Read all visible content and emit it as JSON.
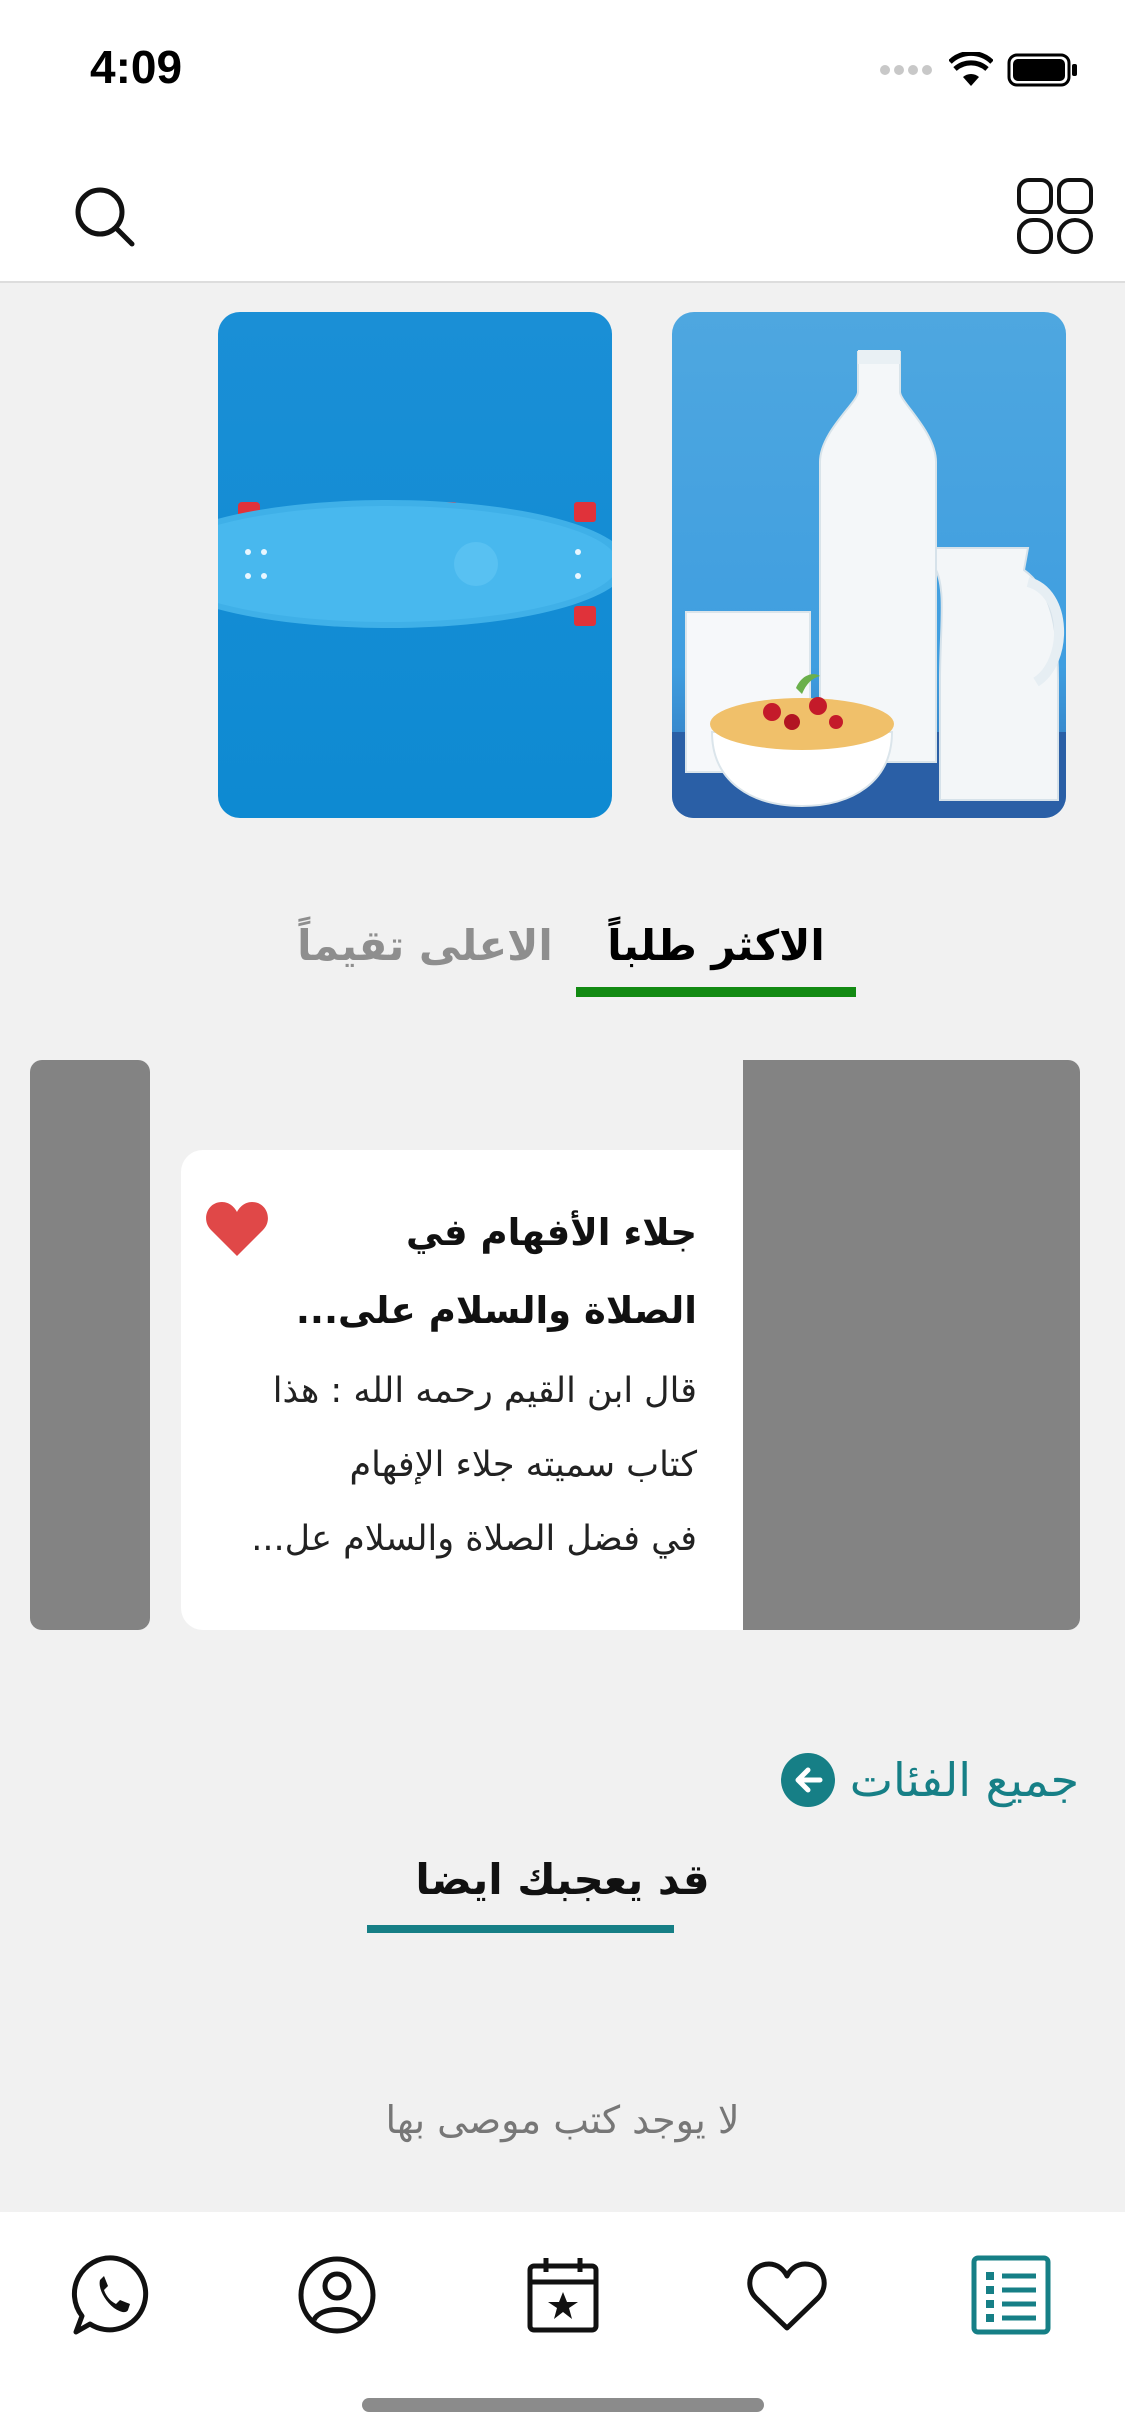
{
  "status_bar": {
    "time": "4:09"
  },
  "tabs": [
    {
      "label": "الاكثر طلباً",
      "active": true
    },
    {
      "label": "الاعلى تقيماً",
      "active": false
    }
  ],
  "book": {
    "title_line1": "جلاء الأفهام في",
    "title_line2": "الصلاة والسلام على...",
    "desc_line1": "قال ابن القيم رحمه الله : هذا",
    "desc_line2": "كتاب سميته جلاء الإفهام",
    "desc_line3": "في فضل الصلاة والسلام عل..."
  },
  "all_categories": {
    "label": "جميع الفئات"
  },
  "recommend": {
    "title": "قد يعجبك ايضا",
    "empty": "لا يوجد كتب موصى بها"
  },
  "bottom_nav": [
    "whatsapp-icon",
    "profile-icon",
    "calendar-icon",
    "heart-icon",
    "list-icon"
  ],
  "colors": {
    "accent_teal": "#167f86",
    "tab_green": "#128a12",
    "heart_red": "#e04848"
  }
}
